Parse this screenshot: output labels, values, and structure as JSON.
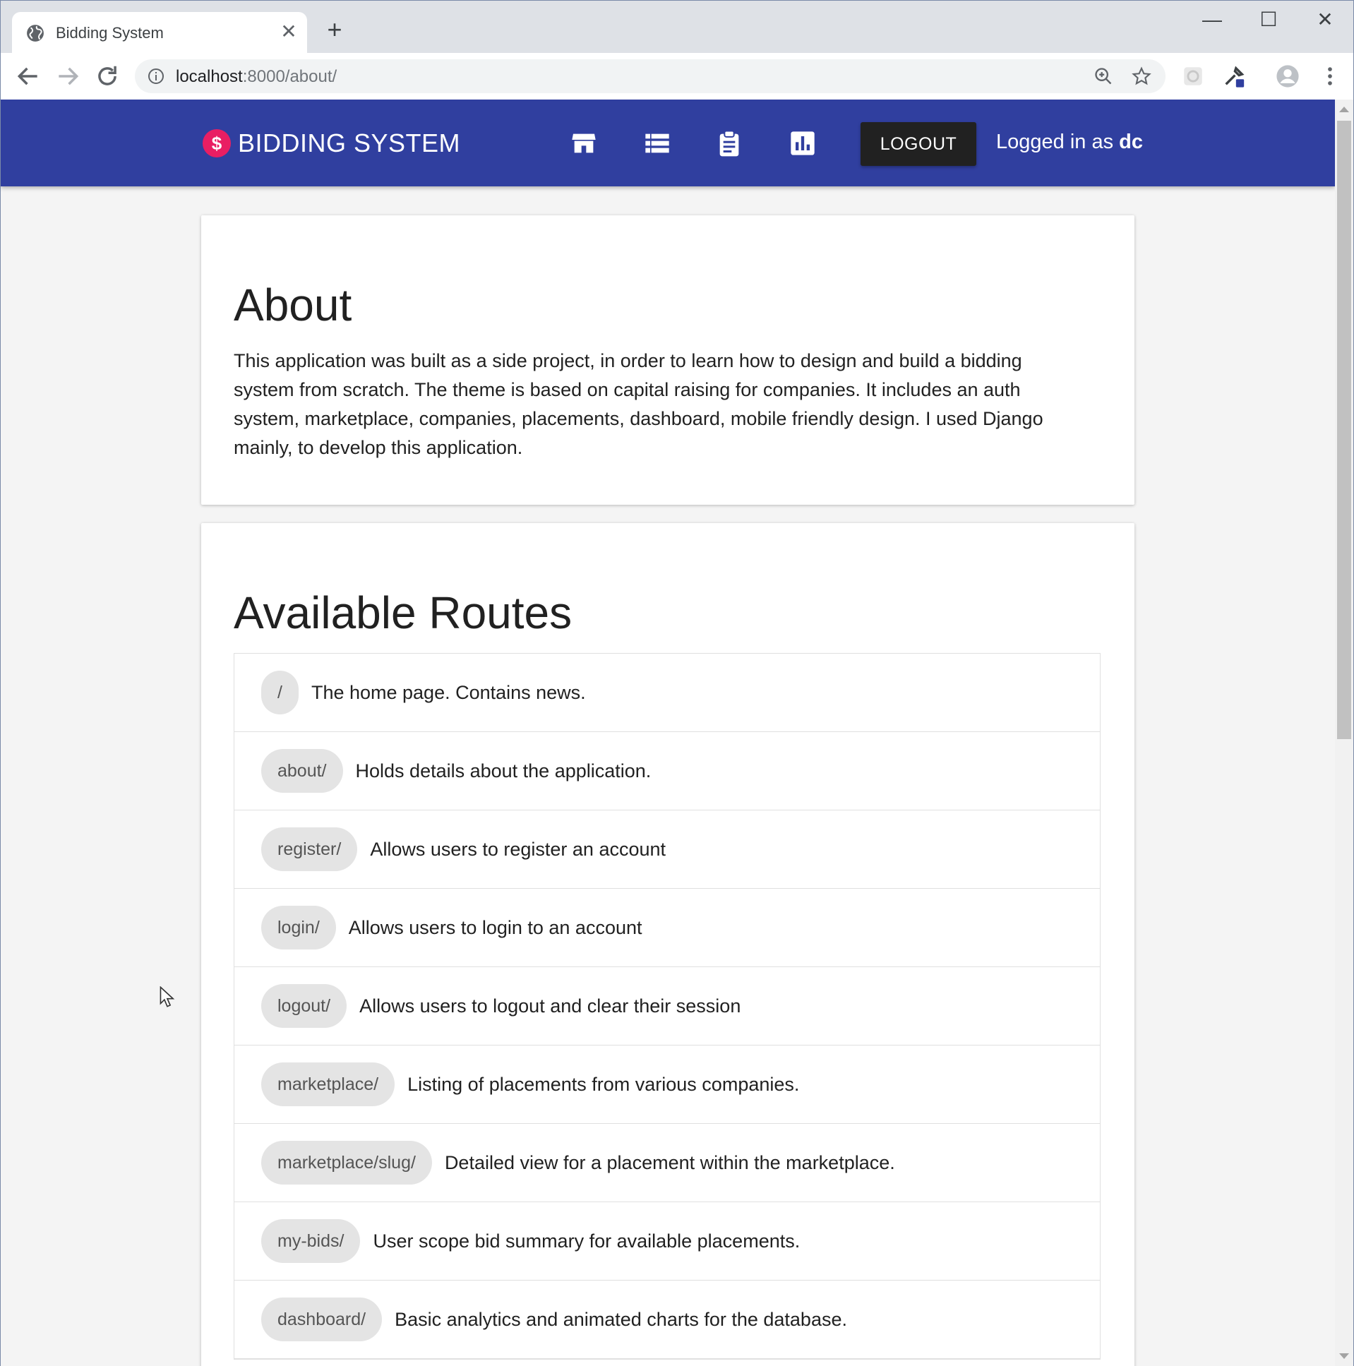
{
  "browser": {
    "tab_title": "Bidding System",
    "new_tab_symbol": "+",
    "close_symbol": "✕",
    "url_host": "localhost",
    "url_path": ":8000/about/",
    "controls": {
      "minimize": "—",
      "maximize": "☐",
      "close": "✕"
    }
  },
  "appbar": {
    "brand_logo": "$",
    "brand_name": "BIDDING SYSTEM",
    "nav_icons": [
      "store-icon",
      "list-icon",
      "clipboard-icon",
      "chart-icon"
    ],
    "logout_label": "LOGOUT",
    "logged_in_prefix": "Logged in as ",
    "username": "dc",
    "bar_color": "#303f9f",
    "logo_color": "#e91e63"
  },
  "about": {
    "title": "About",
    "text": "This application was built as a side project, in order to learn how to design and build a bidding system from scratch. The theme is based on capital raising for companies. It includes an auth system, marketplace, companies, placements, dashboard, mobile friendly design. I used Django mainly, to develop this application."
  },
  "routes": {
    "title": "Available Routes",
    "items": [
      {
        "path": "/",
        "description": "The home page. Contains news."
      },
      {
        "path": "about/",
        "description": "Holds details about the application."
      },
      {
        "path": "register/",
        "description": "Allows users to register an account"
      },
      {
        "path": "login/",
        "description": "Allows users to login to an account"
      },
      {
        "path": "logout/",
        "description": "Allows users to logout and clear their session"
      },
      {
        "path": "marketplace/",
        "description": "Listing of placements from various companies."
      },
      {
        "path": "marketplace/slug/",
        "description": "Detailed view for a placement within the marketplace."
      },
      {
        "path": "my-bids/",
        "description": "User scope bid summary for available placements."
      },
      {
        "path": "dashboard/",
        "description": "Basic analytics and animated charts for the database."
      }
    ]
  }
}
